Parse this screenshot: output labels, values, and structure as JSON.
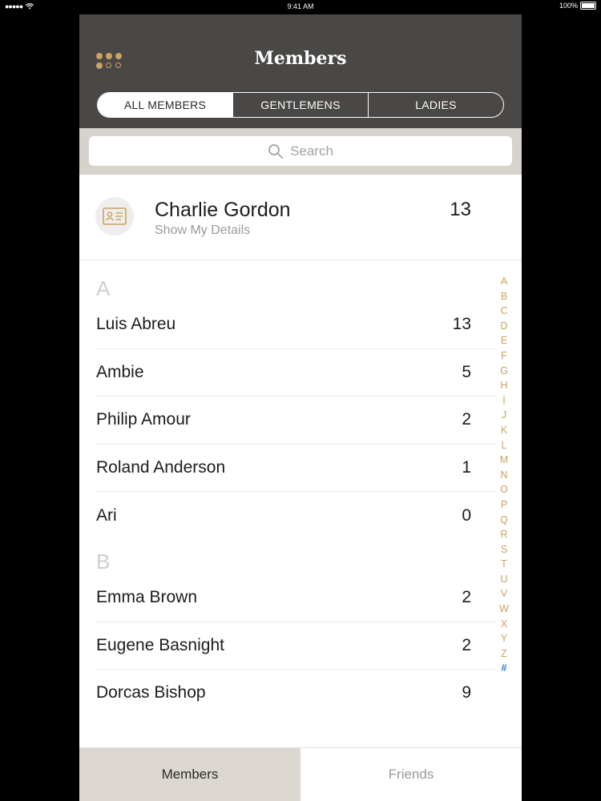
{
  "status_bar": {
    "signal": "●●●●●",
    "time": "9:41 AM",
    "battery": "100%"
  },
  "header": {
    "title": "Members",
    "menu_icon": "grid-dots-icon"
  },
  "segments": [
    {
      "label": "ALL MEMBERS",
      "active": true
    },
    {
      "label": "GENTLEMENS",
      "active": false
    },
    {
      "label": "LADIES",
      "active": false
    }
  ],
  "search": {
    "placeholder": "Search"
  },
  "me": {
    "name": "Charlie Gordon",
    "subtitle": "Show My Details",
    "count": "13",
    "icon": "id-card-icon"
  },
  "sections": [
    {
      "letter": "A",
      "rows": [
        {
          "name": "Luis Abreu",
          "count": "13"
        },
        {
          "name": "Ambie",
          "count": "5"
        },
        {
          "name": "Philip Amour",
          "count": "2"
        },
        {
          "name": "Roland Anderson",
          "count": "1"
        },
        {
          "name": "Ari",
          "count": "0"
        }
      ]
    },
    {
      "letter": "B",
      "rows": [
        {
          "name": "Emma Brown",
          "count": "2"
        },
        {
          "name": "Eugene Basnight",
          "count": "2"
        },
        {
          "name": "Dorcas Bishop",
          "count": "9"
        }
      ]
    }
  ],
  "index": [
    "A",
    "B",
    "C",
    "D",
    "E",
    "F",
    "G",
    "H",
    "I",
    "J",
    "K",
    "L",
    "M",
    "N",
    "O",
    "P",
    "Q",
    "R",
    "S",
    "T",
    "U",
    "V",
    "W",
    "X",
    "Y",
    "Z",
    "#"
  ],
  "tabs": [
    {
      "label": "Members",
      "active": true
    },
    {
      "label": "Friends",
      "active": false
    }
  ],
  "colors": {
    "accent": "#c9a35f",
    "header": "#4a4846",
    "index_hash": "#2d7ed9"
  }
}
